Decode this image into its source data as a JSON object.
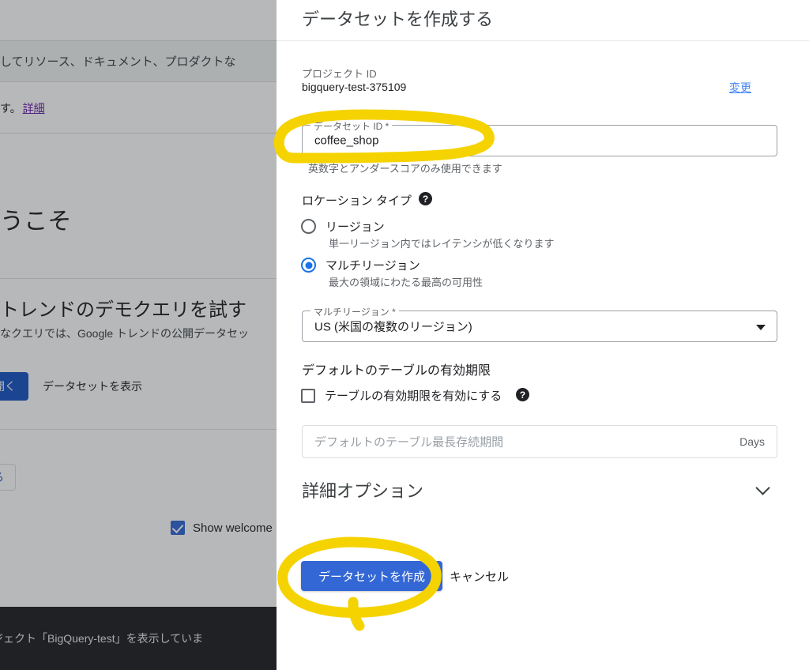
{
  "background": {
    "search_text": "してリソース、ドキュメント、プロダクトな",
    "notice_text": "す。",
    "notice_link": "詳細",
    "welcome_heading": "うこそ",
    "demo_heading": "トレンドのデモクエリを試す",
    "demo_sub": "なクエリでは、Google トレンドの公開データセッ",
    "open_query_button": "エリを開く",
    "view_dataset_button": "データセットを表示",
    "chip_label": "する",
    "show_welcome_label": "Show welcome",
    "snackbar_text": "ロジェクト「BigQuery-test」を表示していま"
  },
  "dialog": {
    "title": "データセットを作成する",
    "project": {
      "label": "プロジェクト ID",
      "value": "bigquery-test-375109",
      "change_link": "変更"
    },
    "dataset_id": {
      "legend": "データセット ID *",
      "value": "coffee_shop",
      "hint": "英数字とアンダースコアのみ使用できます"
    },
    "location_type": {
      "heading": "ロケーション タイプ",
      "help_icon": "question-mark-icon",
      "options": [
        {
          "label": "リージョン",
          "description": "単一リージョン内ではレイテンシが低くなります",
          "selected": false
        },
        {
          "label": "マルチリージョン",
          "description": "最大の領域にわたる最高の可用性",
          "selected": true
        }
      ]
    },
    "multi_region_select": {
      "legend": "マルチリージョン *",
      "value": "US (米国の複数のリージョン)"
    },
    "table_expiration": {
      "heading": "デフォルトのテーブルの有効期限",
      "checkbox_label": "テーブルの有効期限を有効にする",
      "checkbox_checked": false,
      "help_icon": "question-mark-icon",
      "input_placeholder": "デフォルトのテーブル最長存続期間",
      "input_value": "",
      "input_suffix": "Days"
    },
    "advanced_options": {
      "label": "詳細オプション",
      "expand_icon": "chevron-down-icon"
    },
    "actions": {
      "create_label": "データセットを作成",
      "cancel_label": "キャンセル"
    }
  },
  "annotations": {
    "color": "#F5D300",
    "shapes": [
      "ellipse-around-dataset-id-field",
      "ellipse-around-create-dataset-button"
    ]
  },
  "colors": {
    "accent_blue": "#3367d6",
    "link_blue": "#4285f4",
    "radio_selected": "#1a73e8",
    "highlight_yellow": "#F5D300",
    "snackbar_bg": "#202124"
  }
}
